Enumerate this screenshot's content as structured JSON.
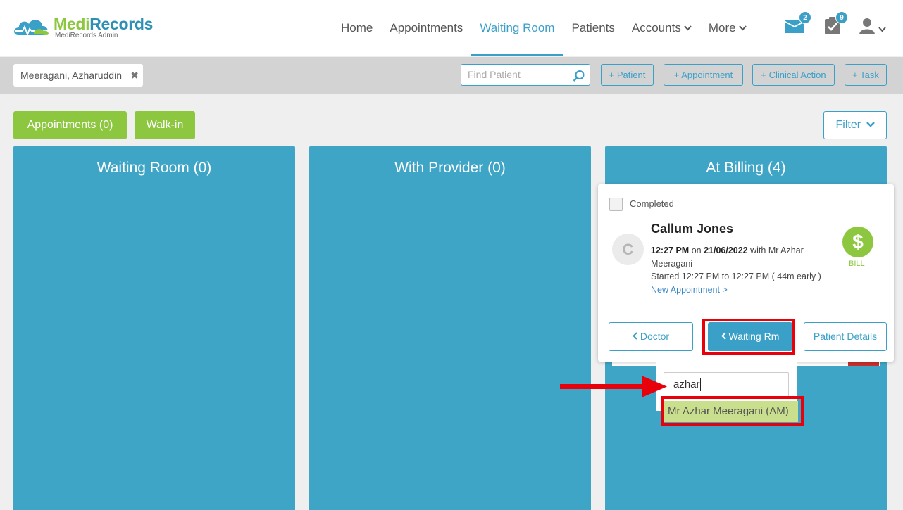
{
  "app": {
    "brand_first": "Medi",
    "brand_second": "Records",
    "brand_sub": "MediRecords Admin"
  },
  "nav": {
    "items": [
      {
        "label": "Home",
        "active": false,
        "dropdown": false
      },
      {
        "label": "Appointments",
        "active": false,
        "dropdown": false
      },
      {
        "label": "Waiting Room",
        "active": true,
        "dropdown": false
      },
      {
        "label": "Patients",
        "active": false,
        "dropdown": false
      },
      {
        "label": "Accounts",
        "active": false,
        "dropdown": true
      },
      {
        "label": "More",
        "active": false,
        "dropdown": true
      }
    ],
    "messages_count": "2",
    "tasks_count": "9"
  },
  "patient_bar": {
    "current_patient": "Meeragani, Azharuddin",
    "find_placeholder": "Find Patient",
    "quick_actions": [
      "+ Patient",
      "+ Appointment",
      "+ Clinical Action",
      "+ Task"
    ]
  },
  "toolbar": {
    "appointments_label": "Appointments (0)",
    "walkin_label": "Walk-in",
    "filter_label": "Filter"
  },
  "columns": [
    {
      "title": "Waiting Room (0)"
    },
    {
      "title": "With Provider (0)"
    },
    {
      "title": "At Billing (4)"
    }
  ],
  "card": {
    "completed_label": "Completed",
    "avatar_initial": "C",
    "patient_name": "Callum Jones",
    "time": "12:27 PM",
    "on_text": "on",
    "date": "21/06/2022",
    "with_text": "with Mr Azhar Meeragani",
    "started_text": "Started 12:27 PM to 12:27 PM ( 44m early )",
    "new_appointment_link": "New Appointment >",
    "bill_symbol": "$",
    "bill_label": "BILL",
    "btn_doctor": "Doctor",
    "btn_waiting": "Waiting Rm",
    "btn_patient_details": "Patient Details"
  },
  "dropdown": {
    "search_value": "azhar",
    "option": "Mr Azhar Meeragani (AM)"
  },
  "colors": {
    "primary": "#3aa0c8",
    "column_bg": "#3fa5c7",
    "green": "#8dc63f",
    "highlight": "#e8000b",
    "option_bg": "#c9df8d"
  }
}
